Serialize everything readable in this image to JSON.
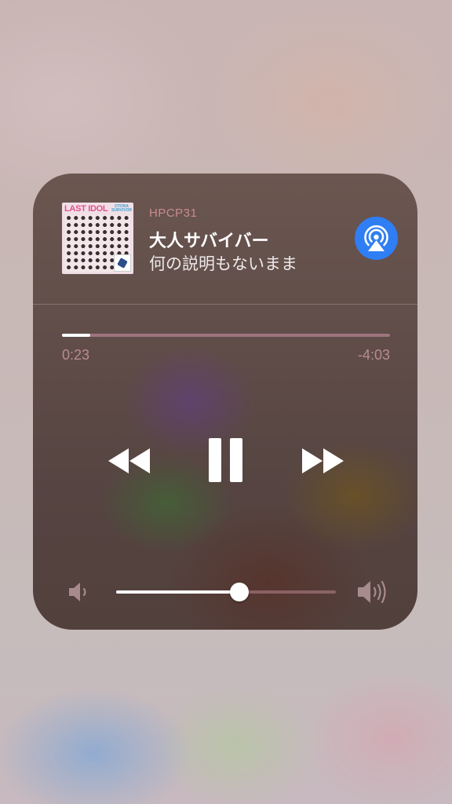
{
  "now_playing": {
    "source_name": "HPCP31",
    "title": "大人サバイバー",
    "subtitle": "何の説明もないまま",
    "album_art": {
      "artist_text": "LAST IDOL",
      "subtitle_text": "OTONA SURVIVOR"
    }
  },
  "playback": {
    "elapsed": "0:23",
    "remaining": "-4:03",
    "progress_fraction": 0.086
  },
  "volume": {
    "level_fraction": 0.56
  },
  "colors": {
    "airplay_accent": "#2f7ef4",
    "time_text": "#b88c8f",
    "source_text": "#c98a90"
  },
  "icons": {
    "airplay": "airplay-audio-icon",
    "rewind": "rewind-icon",
    "pause": "pause-icon",
    "forward": "fast-forward-icon",
    "volume_low": "speaker-low-icon",
    "volume_high": "speaker-high-icon"
  }
}
